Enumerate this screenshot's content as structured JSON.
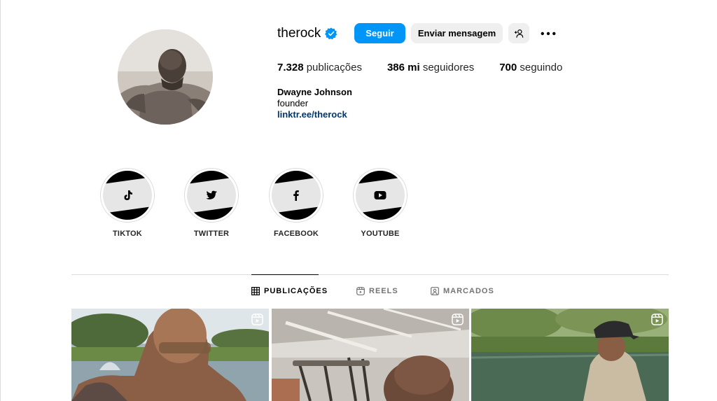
{
  "profile": {
    "username": "therock",
    "follow_label": "Seguir",
    "message_label": "Enviar mensagem",
    "stats": [
      {
        "value": "7.328",
        "label": "publicações"
      },
      {
        "value": "386 mi",
        "label": "seguidores"
      },
      {
        "value": "700",
        "label": "seguindo"
      }
    ],
    "bio": {
      "name": "Dwayne Johnson",
      "text": "founder",
      "link": "linktr.ee/therock"
    }
  },
  "highlights": [
    {
      "label": "TIKTOK",
      "icon": "tiktok-icon"
    },
    {
      "label": "TWITTER",
      "icon": "twitter-icon"
    },
    {
      "label": "FACEBOOK",
      "icon": "facebook-icon"
    },
    {
      "label": "YOUTUBE",
      "icon": "youtube-icon"
    }
  ],
  "tabs": [
    {
      "label": "PUBLICAÇÕES",
      "active": true,
      "icon": "grid-icon"
    },
    {
      "label": "REELS",
      "active": false,
      "icon": "reels-icon"
    },
    {
      "label": "MARCADOS",
      "active": false,
      "icon": "tagged-icon"
    }
  ],
  "colors": {
    "accent": "#0095f6",
    "link": "#00376b",
    "verified": "#0095f6",
    "secondary_button": "#efefef"
  }
}
